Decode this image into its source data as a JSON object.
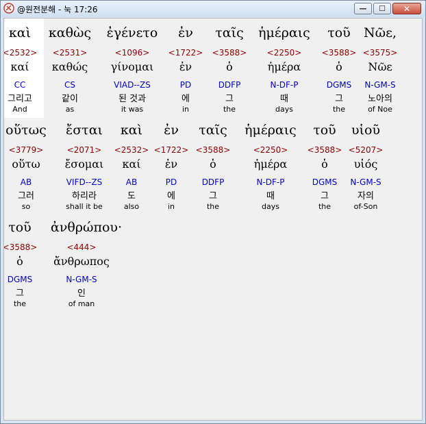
{
  "window": {
    "title": "@원전분해 - 눅 17:26",
    "min_glyph": "—",
    "max_glyph": "☐",
    "close_glyph": "✕"
  },
  "lines": [
    {
      "words": [
        {
          "greek": "καὶ",
          "strong": "<2532>",
          "lemma": "καί",
          "morph": "CC",
          "korean": "그리고",
          "english": "And"
        },
        {
          "greek": "καθὼς",
          "strong": "<2531>",
          "lemma": "καθώς",
          "morph": "CS",
          "korean": "같이",
          "english": "as"
        },
        {
          "greek": "ἐγένετο",
          "strong": "<1096>",
          "lemma": "γίνομαι",
          "morph": "VIAD--ZS",
          "korean": "된 것과",
          "english": "it was"
        },
        {
          "greek": "ἐν",
          "strong": "<1722>",
          "lemma": "ἐν",
          "morph": "PD",
          "korean": "에",
          "english": "in"
        },
        {
          "greek": "ταῖς",
          "strong": "<3588>",
          "lemma": "ὁ",
          "morph": "DDFP",
          "korean": "그",
          "english": "the"
        },
        {
          "greek": "ἡμέραις",
          "strong": "<2250>",
          "lemma": "ἡμέρα",
          "morph": "N-DF-P",
          "korean": "때",
          "english": "days"
        },
        {
          "greek": "τοῦ",
          "strong": "<3588>",
          "lemma": "ὁ",
          "morph": "DGMS",
          "korean": "그",
          "english": "the"
        },
        {
          "greek": "Νῶε,",
          "strong": "<3575>",
          "lemma": "Νῶε",
          "morph": "N-GM-S",
          "korean": "노아의",
          "english": "of Noe"
        }
      ]
    },
    {
      "words": [
        {
          "greek": "οὕτως",
          "strong": "<3779>",
          "lemma": "οὕτω",
          "morph": "AB",
          "korean": "그러",
          "english": "so"
        },
        {
          "greek": "ἔσται",
          "strong": "<2071>",
          "lemma": "ἔσομαι",
          "morph": "VIFD--ZS",
          "korean": "하리라",
          "english": "shall it be"
        },
        {
          "greek": "καὶ",
          "strong": "<2532>",
          "lemma": "καί",
          "morph": "AB",
          "korean": "도",
          "english": "also"
        },
        {
          "greek": "ἐν",
          "strong": "<1722>",
          "lemma": "ἐν",
          "morph": "PD",
          "korean": "에",
          "english": "in"
        },
        {
          "greek": "ταῖς",
          "strong": "<3588>",
          "lemma": "ὁ",
          "morph": "DDFP",
          "korean": "그",
          "english": "the"
        },
        {
          "greek": "ἡμέραις",
          "strong": "<2250>",
          "lemma": "ἡμέρα",
          "morph": "N-DF-P",
          "korean": "때",
          "english": "days"
        },
        {
          "greek": "τοῦ",
          "strong": "<3588>",
          "lemma": "ὁ",
          "morph": "DGMS",
          "korean": "그",
          "english": "the"
        },
        {
          "greek": "υἱοῦ",
          "strong": "<5207>",
          "lemma": "υἱός",
          "morph": "N-GM-S",
          "korean": "자의",
          "english": "of-Son"
        }
      ]
    },
    {
      "words": [
        {
          "greek": "τοῦ",
          "strong": "<3588>",
          "lemma": "ὁ",
          "morph": "DGMS",
          "korean": "그",
          "english": "the"
        },
        {
          "greek": "ἀνθρώπου·",
          "strong": "<444>",
          "lemma": "ἄνθρωπος",
          "morph": "N-GM-S",
          "korean": "인",
          "english": "of man"
        }
      ]
    }
  ]
}
